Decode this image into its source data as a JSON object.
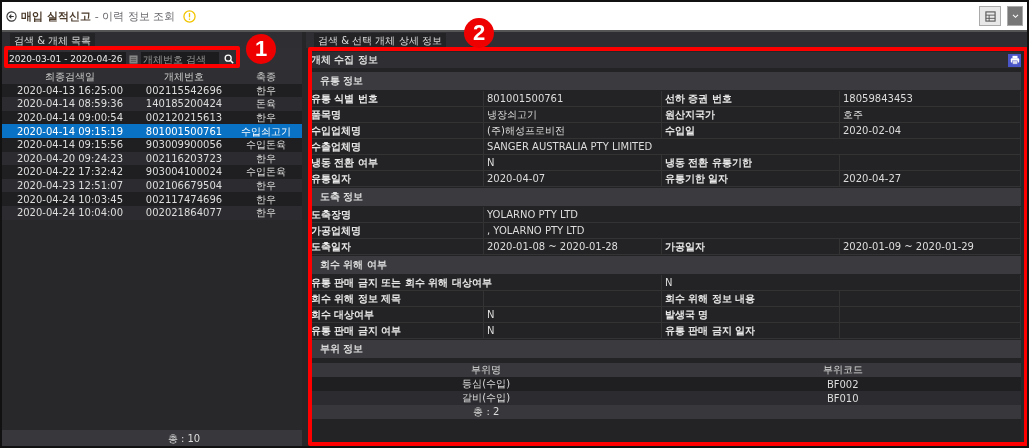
{
  "header": {
    "title": "매입 실적신고",
    "subtitle": "- 이력 정보 조회"
  },
  "left": {
    "tab": "검색 & 개체 목록",
    "search": {
      "date_range": "2020-03-01 - 2020-04-26",
      "placeholder": "개체번호 검색"
    },
    "columns": [
      "최종검색일",
      "개체번호",
      "축종"
    ],
    "rows": [
      {
        "cells": [
          "2020-04-13 16:25:00",
          "002115542696",
          "한우"
        ],
        "selected": false
      },
      {
        "cells": [
          "2020-04-14 08:59:36",
          "140185200424",
          "돈육"
        ],
        "selected": false
      },
      {
        "cells": [
          "2020-04-14 09:00:54",
          "002120215613",
          "한우"
        ],
        "selected": false
      },
      {
        "cells": [
          "2020-04-14 09:15:19",
          "801001500761",
          "수입쇠고기"
        ],
        "selected": true
      },
      {
        "cells": [
          "2020-04-14 09:15:56",
          "903009900056",
          "수입돈육"
        ],
        "selected": false
      },
      {
        "cells": [
          "2020-04-20 09:24:23",
          "002116203723",
          "한우"
        ],
        "selected": false
      },
      {
        "cells": [
          "2020-04-22 17:32:42",
          "903004100024",
          "수입돈육"
        ],
        "selected": false
      },
      {
        "cells": [
          "2020-04-23 12:51:07",
          "002106679504",
          "한우"
        ],
        "selected": false
      },
      {
        "cells": [
          "2020-04-24 10:03:45",
          "002117474696",
          "한우"
        ],
        "selected": false
      },
      {
        "cells": [
          "2020-04-24 10:04:00",
          "002021864077",
          "한우"
        ],
        "selected": false
      }
    ],
    "total": "총 : 10"
  },
  "right": {
    "tab": "검색 & 선택 개체 상세 정보",
    "panel_title": "개체 수집 정보",
    "sections": [
      {
        "kind": "fields",
        "title": "유통 정보",
        "rows": [
          {
            "kind": "half",
            "pairs": [
              {
                "label": "유통 식별 번호",
                "value": "801001500761"
              },
              {
                "label": "선하 증권 번호",
                "value": "18059843453"
              }
            ]
          },
          {
            "kind": "half",
            "pairs": [
              {
                "label": "품목명",
                "value": "냉장쇠고기"
              },
              {
                "label": "원산지국가",
                "value": "호주"
              }
            ]
          },
          {
            "kind": "half",
            "pairs": [
              {
                "label": "수입업체명",
                "value": "(주)해성프로비전"
              },
              {
                "label": "수입일",
                "value": "2020-02-04"
              }
            ]
          },
          {
            "kind": "full",
            "pairs": [
              {
                "label": "수출업체명",
                "value": "SANGER AUSTRALIA PTY LIMITED"
              }
            ]
          },
          {
            "kind": "half",
            "pairs": [
              {
                "label": "냉동 전환 여부",
                "value": "N"
              },
              {
                "label": "냉동 전환 유통기한"
              }
            ]
          },
          {
            "kind": "half",
            "pairs": [
              {
                "label": "유통일자",
                "value": "2020-04-07"
              },
              {
                "label": "유통기한 일자",
                "value": "2020-04-27"
              }
            ]
          }
        ]
      },
      {
        "kind": "fields",
        "title": "도축 정보",
        "rows": [
          {
            "kind": "full",
            "pairs": [
              {
                "label": "도축장명",
                "value": "YOLARNO PTY LTD"
              }
            ]
          },
          {
            "kind": "full",
            "pairs": [
              {
                "label": "가공업체명",
                "value": ", YOLARNO PTY LTD"
              }
            ]
          },
          {
            "kind": "half",
            "pairs": [
              {
                "label": "도축일자",
                "value": "2020-01-08 ~ 2020-01-28"
              },
              {
                "label": "가공일자",
                "value": "2020-01-09 ~ 2020-01-29"
              }
            ]
          }
        ]
      },
      {
        "kind": "fields",
        "title": "회수 위해 여부",
        "rows": [
          {
            "kind": "wide",
            "pairs": [
              {
                "label": "유통 판매 금지 또는 회수 위해 대상여부",
                "value": "N"
              }
            ]
          },
          {
            "kind": "half",
            "pairs": [
              {
                "label": "회수 위해 정보 제목"
              },
              {
                "label": "회수 위해 정보 내용"
              }
            ]
          },
          {
            "kind": "half",
            "pairs": [
              {
                "label": "회수 대상여부",
                "value": "N"
              },
              {
                "label": "발생국 명"
              }
            ]
          },
          {
            "kind": "half",
            "pairs": [
              {
                "label": "유통 판매 금지 여부",
                "value": "N"
              },
              {
                "label": "유통 판매 금지 일자"
              }
            ]
          }
        ]
      },
      {
        "kind": "table",
        "title": "부위 정보",
        "columns": [
          "부위명",
          "부위코드"
        ],
        "rows": [
          [
            "등심(수입)",
            "BF002"
          ],
          [
            "갈비(수입)",
            "BF010"
          ]
        ],
        "total": "총 : 2"
      }
    ]
  },
  "annotations": [
    {
      "number": "1"
    },
    {
      "number": "2"
    }
  ]
}
